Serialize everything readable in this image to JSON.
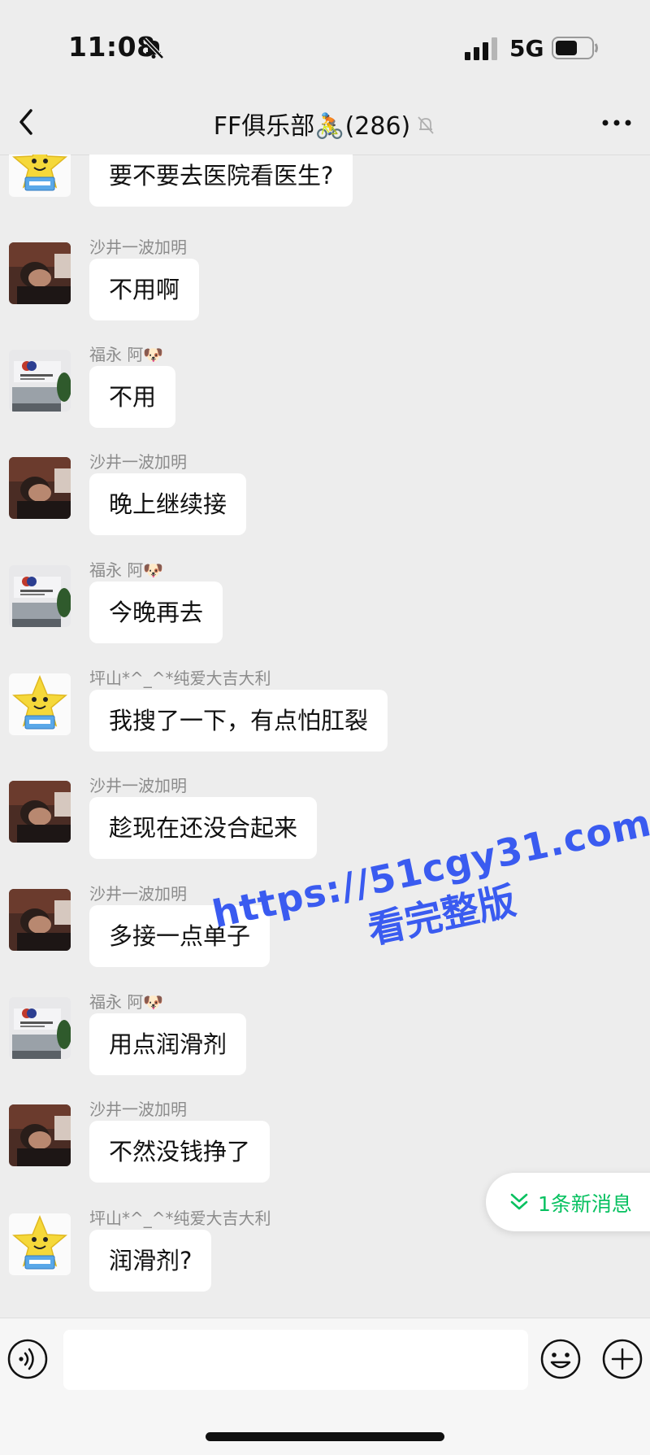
{
  "status_bar": {
    "time": "11:08",
    "network": "5G"
  },
  "nav": {
    "title": "FF俱乐部",
    "title_emoji": "🚴",
    "member_count": "(286)"
  },
  "messages": [
    {
      "avatar": "star",
      "sender": "",
      "text": "要不要去医院看医生?"
    },
    {
      "avatar": "man",
      "sender": "沙井一波加明",
      "text": "不用啊"
    },
    {
      "avatar": "office",
      "sender": "福永 阿🐶",
      "text": "不用"
    },
    {
      "avatar": "man",
      "sender": "沙井一波加明",
      "text": "晚上继续接"
    },
    {
      "avatar": "office",
      "sender": "福永 阿🐶",
      "text": "今晚再去"
    },
    {
      "avatar": "star",
      "sender": "坪山*^_^*纯爱大吉大利",
      "text": "我搜了一下，有点怕肛裂"
    },
    {
      "avatar": "man",
      "sender": "沙井一波加明",
      "text": "趁现在还没合起来"
    },
    {
      "avatar": "man",
      "sender": "沙井一波加明",
      "text": "多接一点单子"
    },
    {
      "avatar": "office",
      "sender": "福永 阿🐶",
      "text": "用点润滑剂"
    },
    {
      "avatar": "man",
      "sender": "沙井一波加明",
      "text": "不然没钱挣了"
    },
    {
      "avatar": "star",
      "sender": "坪山*^_^*纯爱大吉大利",
      "text": "润滑剂?"
    }
  ],
  "new_message_pill": "1条新消息",
  "watermark": {
    "line1": "https://51cgy31.com",
    "line2": "看完整版"
  },
  "colors": {
    "accent": "#07c160",
    "watermark": "#3a5bf0",
    "background": "#ededed"
  }
}
